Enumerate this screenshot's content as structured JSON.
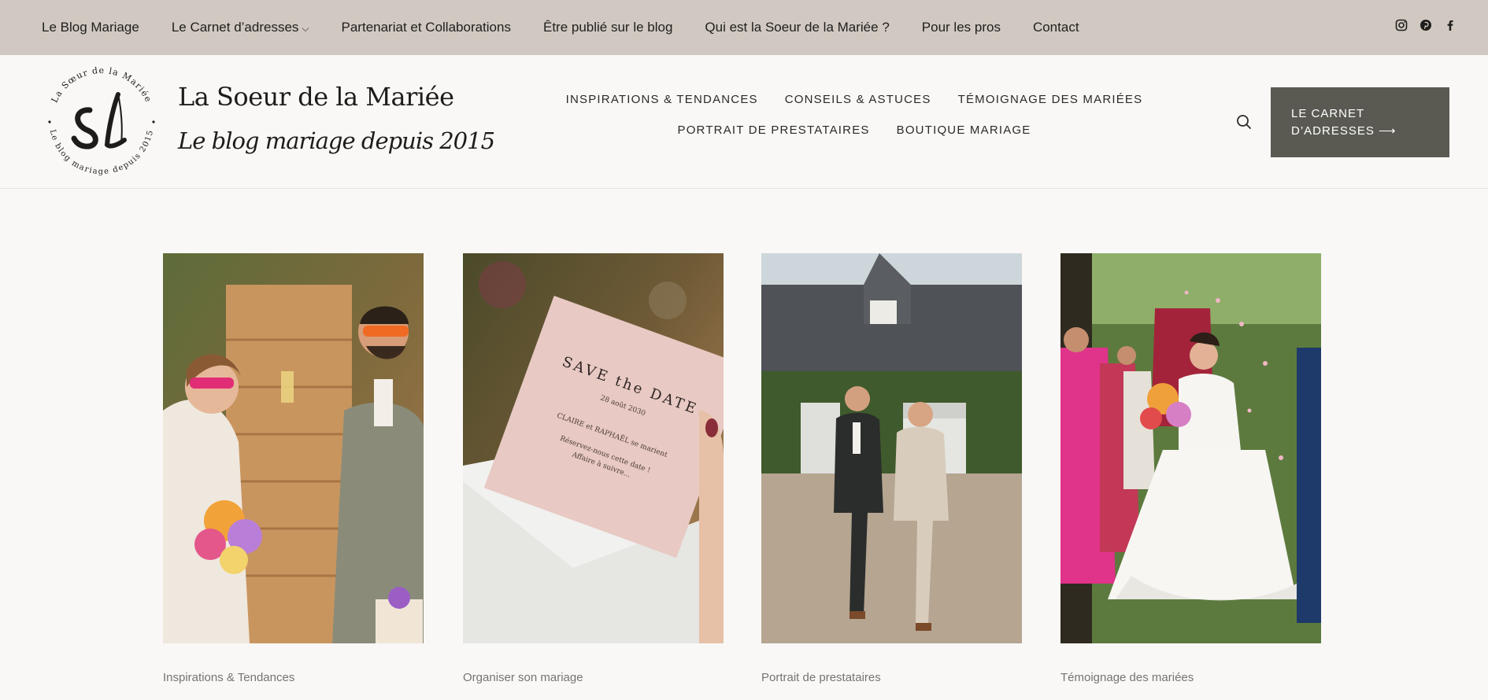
{
  "topbar": {
    "nav": [
      {
        "label": "Le Blog Mariage"
      },
      {
        "label": "Le Carnet d’adresses",
        "has_dropdown": true
      },
      {
        "label": "Partenariat et Collaborations"
      },
      {
        "label": "Être publié sur le blog"
      },
      {
        "label": "Qui est la Soeur de la Mariée ?"
      },
      {
        "label": "Pour les pros"
      },
      {
        "label": "Contact"
      }
    ],
    "social": [
      "instagram-icon",
      "pinterest-icon",
      "facebook-icon"
    ]
  },
  "header": {
    "logo_ring_top": "La Sœur de la Mariée",
    "logo_ring_bottom": "Le blog mariage depuis 2015",
    "title": "La Soeur de la Mariée",
    "tagline": "Le blog mariage depuis 2015",
    "nav": [
      "INSPIRATIONS & TENDANCES",
      "CONSEILS & ASTUCES",
      "TÉMOIGNAGE DES MARIÉES",
      "PORTRAIT DE PRESTATAIRES",
      "BOUTIQUE MARIAGE"
    ],
    "search_icon": "search-icon",
    "cta_line1": "LE CARNET",
    "cta_line2": "D’ADRESSES ⟶"
  },
  "cards": [
    {
      "category": "Inspirations & Tendances",
      "save_the_date": "",
      "names": "",
      "date": ""
    },
    {
      "category": "Organiser son mariage",
      "save_the_date": "SAVE the DATE",
      "date": "28 août 2030",
      "names": "CLAIRE et RAPHAËL se marient",
      "line2": "Réservez-nous cette date !",
      "line3": "Affaire à suivre..."
    },
    {
      "category": "Portrait de prestataires"
    },
    {
      "category": "Témoignage des mariées"
    }
  ],
  "colors": {
    "topbar_bg": "#d1c9c1",
    "page_bg": "#f9f8f6",
    "cta_bg": "#5a5a53",
    "text": "#2b2a28",
    "muted": "#757470"
  }
}
